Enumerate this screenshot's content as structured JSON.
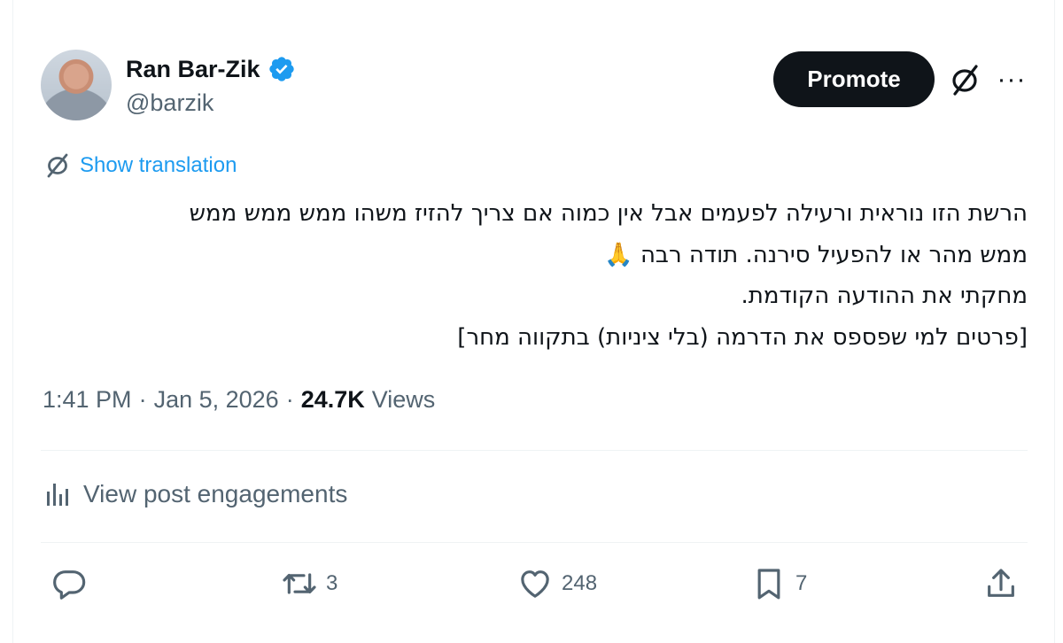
{
  "author": {
    "name": "Ran Bar-Zik",
    "handle": "@barzik",
    "verified": true,
    "verified_color": "#1d9bf0"
  },
  "header_actions": {
    "promote_label": "Promote",
    "grok_icon": "grok-icon",
    "more_label": "···"
  },
  "translation": {
    "label": "Show translation",
    "icon": "grok-icon",
    "color": "#1d9bf0"
  },
  "tweet": {
    "lines": [
      "הרשת הזו נוראית ורעילה לפעמים אבל אין כמוה אם צריך להזיז משהו ממש ממש ממש",
      "ממש מהר או להפעיל סירנה. תודה רבה 🙏",
      "מחקתי את ההודעה הקודמת.",
      "[פרטים למי שפספס את הדרמה (בלי ציניות) בתקווה מחר]"
    ]
  },
  "meta": {
    "time": "1:41 PM",
    "separator": "·",
    "date": "Jan 5, 2026",
    "separator2": "·",
    "views_count": "24.7K",
    "views_label": "Views"
  },
  "engagements": {
    "label": "View post engagements",
    "icon": "analytics-icon"
  },
  "actions": {
    "reply": {
      "icon": "reply-icon",
      "count": ""
    },
    "retweet": {
      "icon": "retweet-icon",
      "count": "3"
    },
    "like": {
      "icon": "heart-icon",
      "count": "248"
    },
    "bookmark": {
      "icon": "bookmark-icon",
      "count": "7"
    },
    "share": {
      "icon": "share-icon",
      "count": ""
    }
  },
  "colors": {
    "text_primary": "#0f1419",
    "text_secondary": "#536471",
    "accent": "#1d9bf0",
    "divider": "#eff3f4"
  }
}
